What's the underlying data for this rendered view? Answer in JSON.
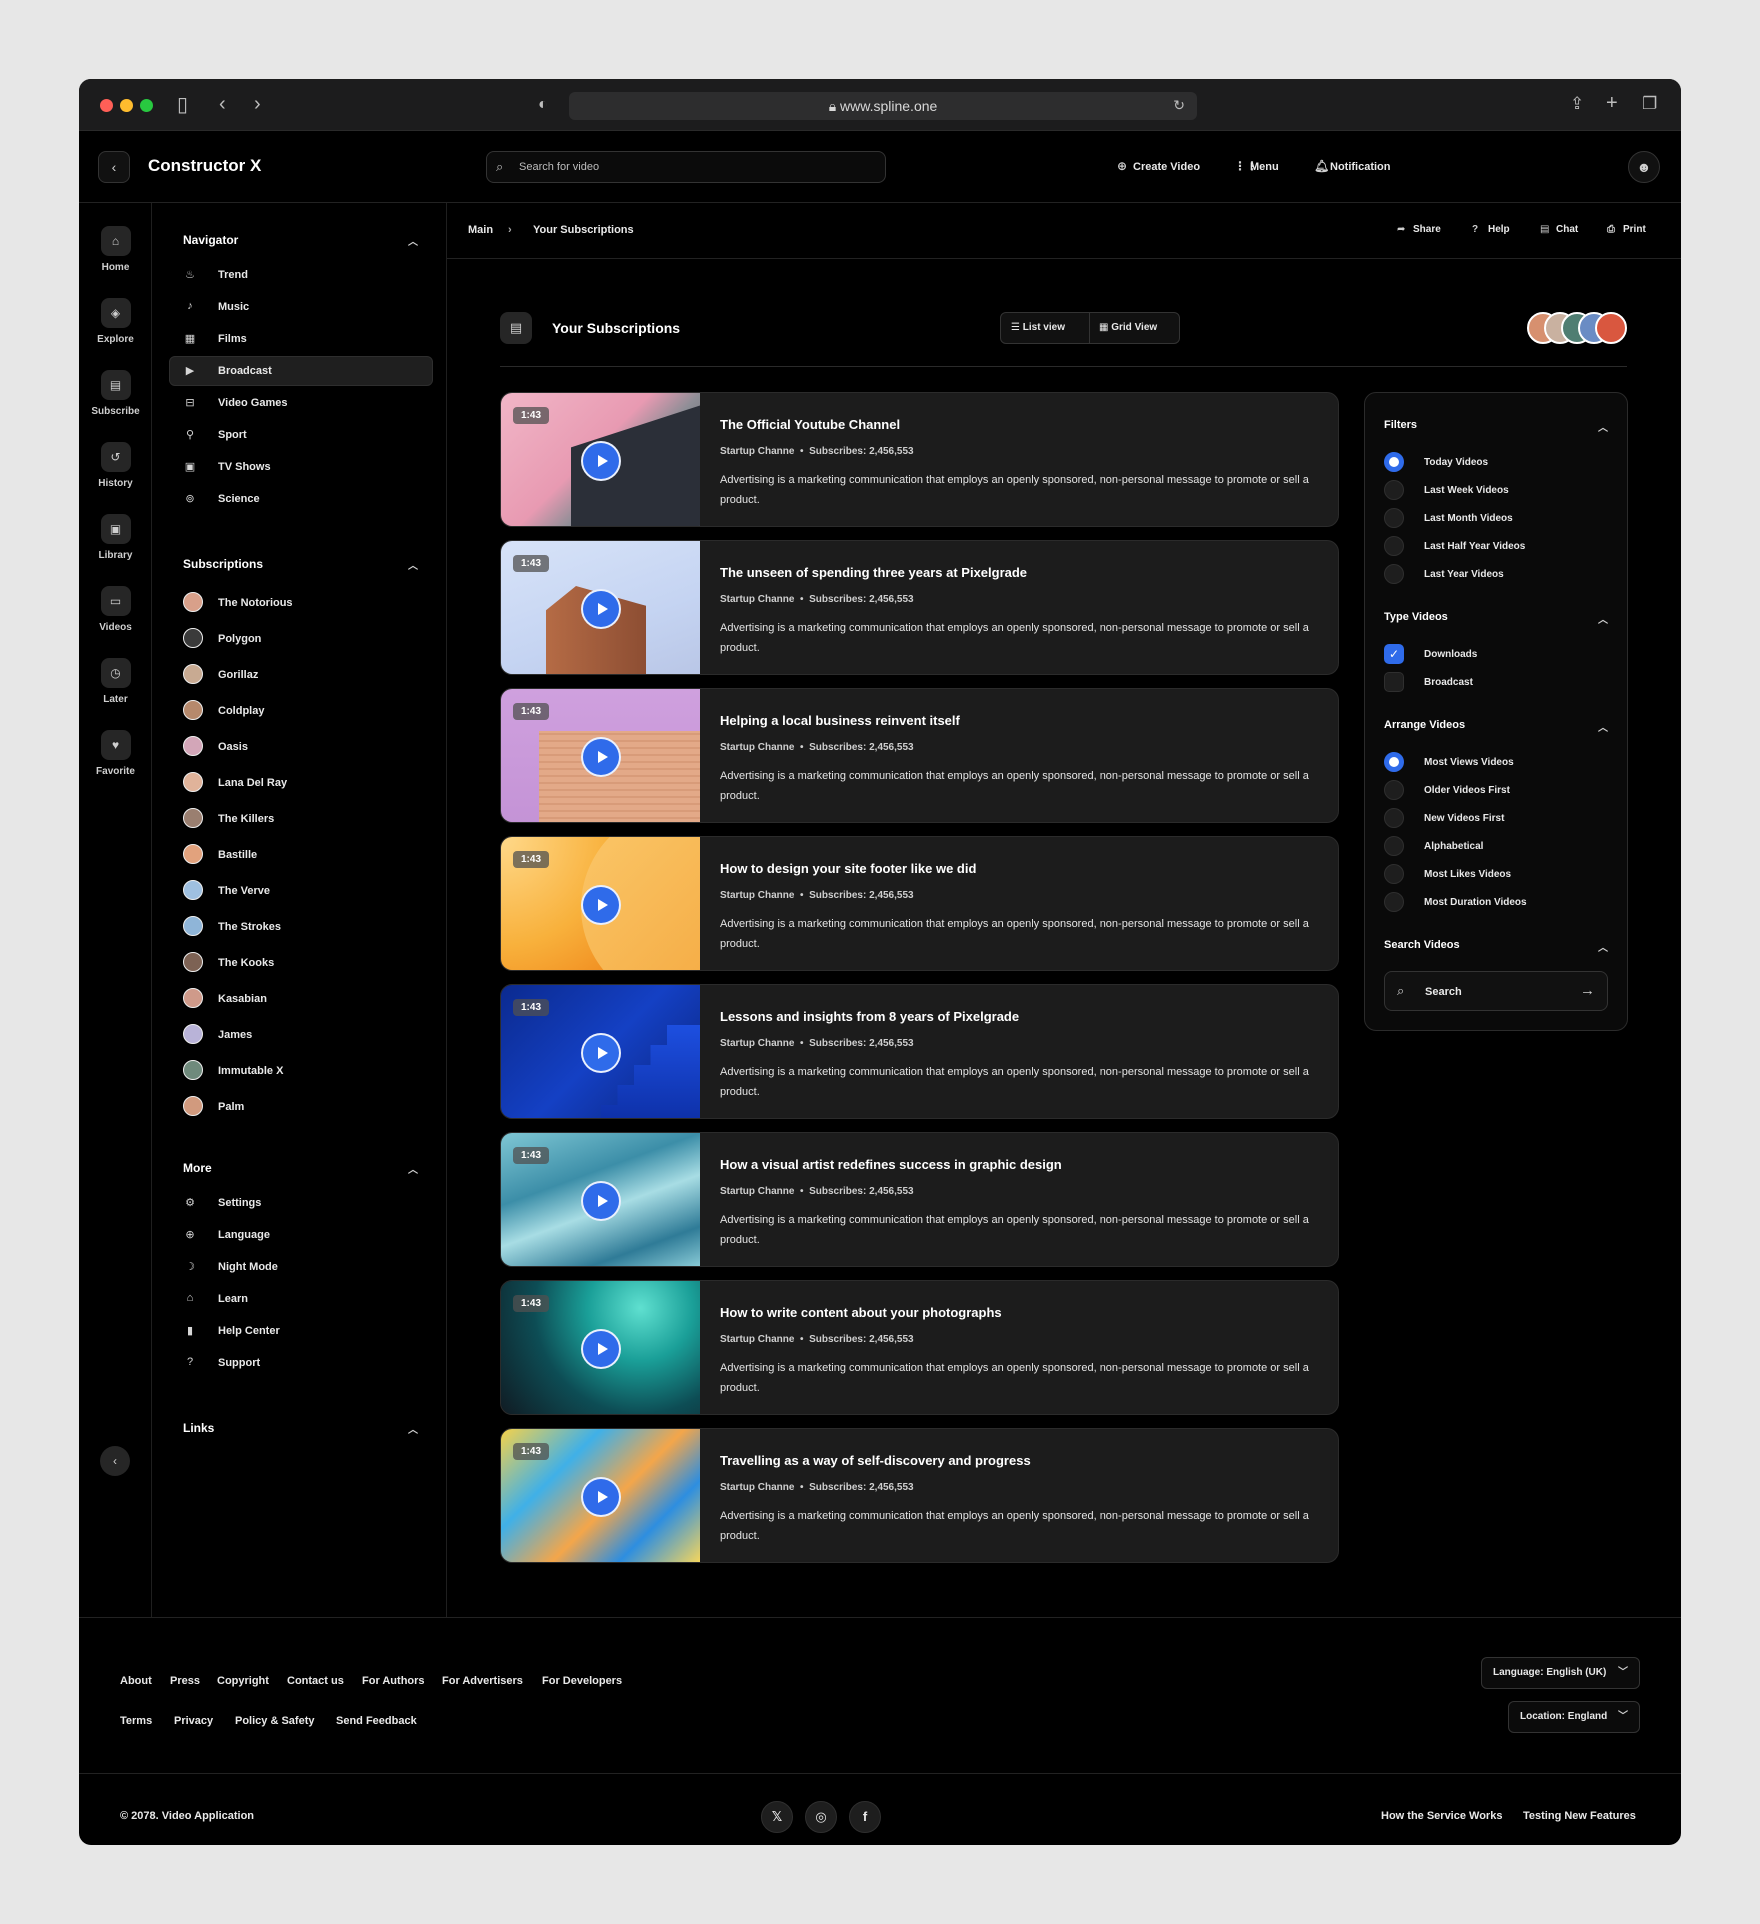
{
  "browser": {
    "url": "www.spline.one"
  },
  "header": {
    "brand": "Constructor X",
    "search_placeholder": "Search for video",
    "actions": [
      {
        "label": "Create Video",
        "icon": "plus-circle-icon"
      },
      {
        "label": "Menu",
        "icon": "grid-icon"
      },
      {
        "label": "Notification",
        "icon": "bell-icon"
      }
    ]
  },
  "rail": [
    {
      "label": "Home",
      "icon": "home-icon"
    },
    {
      "label": "Explore",
      "icon": "compass-icon"
    },
    {
      "label": "Subscribe",
      "icon": "subscribe-icon"
    },
    {
      "label": "History",
      "icon": "history-icon"
    },
    {
      "label": "Library",
      "icon": "library-icon"
    },
    {
      "label": "Videos",
      "icon": "videos-icon"
    },
    {
      "label": "Later",
      "icon": "clock-icon"
    },
    {
      "label": "Favorite",
      "icon": "heart-icon"
    }
  ],
  "sidebar": {
    "navigator_title": "Navigator",
    "navigator": [
      {
        "label": "Trend",
        "icon": "fire-icon"
      },
      {
        "label": "Music",
        "icon": "music-icon"
      },
      {
        "label": "Films",
        "icon": "film-icon"
      },
      {
        "label": "Broadcast",
        "icon": "broadcast-icon",
        "active": true
      },
      {
        "label": "Video Games",
        "icon": "gamepad-icon"
      },
      {
        "label": "Sport",
        "icon": "running-icon"
      },
      {
        "label": "TV Shows",
        "icon": "tv-icon"
      },
      {
        "label": "Science",
        "icon": "atom-icon"
      }
    ],
    "subscriptions_title": "Subscriptions",
    "subscriptions": [
      "The Notorious",
      "Polygon",
      "Gorillaz",
      "Coldplay",
      "Oasis",
      "Lana Del Ray",
      "The Killers",
      "Bastille",
      "The Verve",
      "The Strokes",
      "The Kooks",
      "Kasabian",
      "James",
      "Immutable X",
      "Palm"
    ],
    "more_title": "More",
    "more": [
      {
        "label": "Settings",
        "icon": "gear-icon"
      },
      {
        "label": "Language",
        "icon": "globe-icon"
      },
      {
        "label": "Night Mode",
        "icon": "moon-icon"
      },
      {
        "label": "Learn",
        "icon": "graduation-cap-icon"
      },
      {
        "label": "Help Center",
        "icon": "document-icon"
      },
      {
        "label": "Support",
        "icon": "question-icon"
      }
    ],
    "links_title": "Links"
  },
  "breadcrumb": {
    "root": "Main",
    "current": "Your Subscriptions"
  },
  "toolbar": [
    {
      "label": "Share",
      "icon": "share-icon"
    },
    {
      "label": "Help",
      "icon": "help-icon"
    },
    {
      "label": "Chat",
      "icon": "chat-icon"
    },
    {
      "label": "Print",
      "icon": "print-icon"
    }
  ],
  "page": {
    "title": "Your Subscriptions",
    "list_view": "List view",
    "grid_view": "Grid View"
  },
  "videos": [
    {
      "duration": "1:43",
      "title": "The Official Youtube Channel",
      "channel": "Startup Channe",
      "subscribers": "Subscribes: 2,456,553",
      "description": "Advertising is a marketing communication that employs an openly sponsored, non-personal message to promote or sell a product."
    },
    {
      "duration": "1:43",
      "title": "The unseen of spending three years at Pixelgrade",
      "channel": "Startup Channe",
      "subscribers": "Subscribes: 2,456,553",
      "description": "Advertising is a marketing communication that employs an openly sponsored, non-personal message to promote or sell a product."
    },
    {
      "duration": "1:43",
      "title": "Helping a local business reinvent itself",
      "channel": "Startup Channe",
      "subscribers": "Subscribes: 2,456,553",
      "description": "Advertising is a marketing communication that employs an openly sponsored, non-personal message to promote or sell a product."
    },
    {
      "duration": "1:43",
      "title": "How to design your site footer like we did",
      "channel": "Startup Channe",
      "subscribers": "Subscribes: 2,456,553",
      "description": "Advertising is a marketing communication that employs an openly sponsored, non-personal message to promote or sell a product."
    },
    {
      "duration": "1:43",
      "title": "Lessons and insights from 8 years of Pixelgrade",
      "channel": "Startup Channe",
      "subscribers": "Subscribes: 2,456,553",
      "description": "Advertising is a marketing communication that employs an openly sponsored, non-personal message to promote or sell a product."
    },
    {
      "duration": "1:43",
      "title": "How a visual artist redefines success in graphic design",
      "channel": "Startup Channe",
      "subscribers": "Subscribes: 2,456,553",
      "description": "Advertising is a marketing communication that employs an openly sponsored, non-personal message to promote or sell a product."
    },
    {
      "duration": "1:43",
      "title": "How to write content about your photographs",
      "channel": "Startup Channe",
      "subscribers": "Subscribes: 2,456,553",
      "description": "Advertising is a marketing communication that employs an openly sponsored, non-personal message to promote or sell a product."
    },
    {
      "duration": "1:43",
      "title": "Travelling as a way of self-discovery and progress",
      "channel": "Startup Channe",
      "subscribers": "Subscribes: 2,456,553",
      "description": "Advertising is a marketing communication that employs an openly sponsored, non-personal message to promote or sell a product."
    }
  ],
  "filters": {
    "filters_title": "Filters",
    "filters": [
      {
        "label": "Today Videos",
        "selected": true
      },
      {
        "label": "Last Week Videos",
        "selected": false
      },
      {
        "label": "Last Month Videos",
        "selected": false
      },
      {
        "label": "Last Half Year Videos",
        "selected": false
      },
      {
        "label": "Last Year Videos",
        "selected": false
      }
    ],
    "type_title": "Type Videos",
    "types": [
      {
        "label": "Downloads",
        "checked": true
      },
      {
        "label": "Broadcast",
        "checked": false
      }
    ],
    "arrange_title": "Arrange Videos",
    "arrange": [
      {
        "label": "Most Views Videos",
        "selected": true
      },
      {
        "label": "Older Videos First",
        "selected": false
      },
      {
        "label": "New Videos First",
        "selected": false
      },
      {
        "label": "Alphabetical",
        "selected": false
      },
      {
        "label": "Most Likes Videos",
        "selected": false
      },
      {
        "label": "Most Duration Videos",
        "selected": false
      }
    ],
    "search_title": "Search Videos",
    "search_placeholder": "Search"
  },
  "footer": {
    "links_row1": [
      "About",
      "Press",
      "Copyright",
      "Contact us",
      "For Authors",
      "For Advertisers",
      "For Developers"
    ],
    "links_row2": [
      "Terms",
      "Privacy",
      "Policy & Safety",
      "Send Feedback"
    ],
    "language": "Language: English (UK)",
    "location": "Location: England",
    "copyright": "© 2078. Video Application",
    "bottom_links": [
      "How the Service Works",
      "Testing New Features"
    ],
    "social": [
      {
        "glyph": "𝕏",
        "icon": "x-icon"
      },
      {
        "glyph": "◎",
        "icon": "instagram-icon"
      },
      {
        "glyph": "f",
        "icon": "facebook-icon"
      }
    ]
  },
  "colors": {
    "accent": "#2f6bea",
    "background": "#000000",
    "card": "#1c1c1c"
  }
}
